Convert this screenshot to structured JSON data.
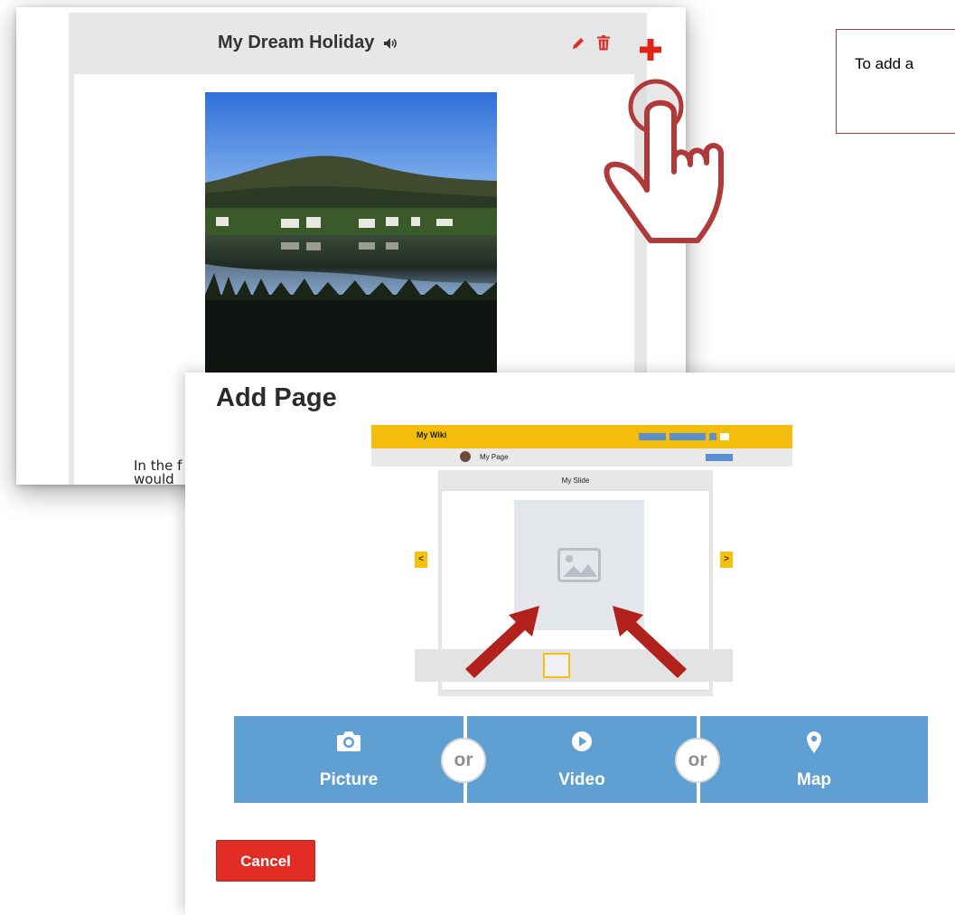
{
  "slide_view": {
    "title": "My Dream Holiday",
    "text_line1": "In the f",
    "text_line2": "would",
    "icons": {
      "speaker": "speaker-icon",
      "edit": "pencil-icon",
      "delete": "trash-icon",
      "add": "plus-icon",
      "pointer": "hand-pointer-icon"
    }
  },
  "instruction": {
    "text": "To add a"
  },
  "dialog": {
    "title": "Add Page",
    "preview": {
      "wiki_title": "My Wiki",
      "page_name": "My Page",
      "slide_title": "My Slide",
      "prev_label": "<",
      "next_label": ">"
    },
    "options": [
      {
        "label": "Picture",
        "icon": "camera-icon"
      },
      {
        "label": "Video",
        "icon": "play-icon"
      },
      {
        "label": "Map",
        "icon": "map-pin-icon"
      }
    ],
    "or_label_1": "or",
    "or_label_2": "or",
    "cancel_label": "Cancel"
  },
  "colors": {
    "accent_blue": "#5f9fd2",
    "cancel_red": "#e12d24",
    "toolbar_yellow": "#f4bd0c",
    "plus_red": "#e2231a",
    "hand_red": "#b03a3a"
  }
}
